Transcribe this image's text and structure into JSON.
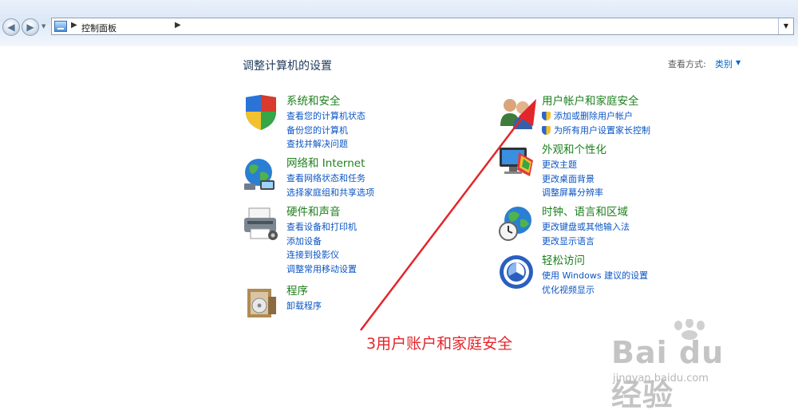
{
  "address_bar": {
    "path": "控制面板"
  },
  "header": {
    "title": "调整计算机的设置",
    "view_by_label": "查看方式:",
    "view_by_value": "类别"
  },
  "categories_left": [
    {
      "title": "系统和安全",
      "links": [
        "查看您的计算机状态",
        "备份您的计算机",
        "查找并解决问题"
      ]
    },
    {
      "title": "网络和 Internet",
      "links": [
        "查看网络状态和任务",
        "选择家庭组和共享选项"
      ]
    },
    {
      "title": "硬件和声音",
      "links": [
        "查看设备和打印机",
        "添加设备",
        "连接到投影仪",
        "调整常用移动设置"
      ]
    },
    {
      "title": "程序",
      "links": [
        "卸载程序"
      ]
    }
  ],
  "categories_right": [
    {
      "title": "用户帐户和家庭安全",
      "links": [
        "添加或删除用户帐户",
        "为所有用户设置家长控制"
      ]
    },
    {
      "title": "外观和个性化",
      "links": [
        "更改主题",
        "更改桌面背景",
        "调整屏幕分辨率"
      ]
    },
    {
      "title": "时钟、语言和区域",
      "links": [
        "更改键盘或其他输入法",
        "更改显示语言"
      ]
    },
    {
      "title": "轻松访问",
      "links": [
        "使用 Windows 建议的设置",
        "优化视频显示"
      ]
    }
  ],
  "annotation": {
    "text": "3用户账户和家庭安全",
    "color": "#e3262b"
  },
  "watermark": {
    "main": "Bai du 经验",
    "sub": "jingyan.baidu.com"
  },
  "colors": {
    "category_title": "#1e7f1e",
    "link": "#0b55c4",
    "page_title": "#1e395b"
  }
}
